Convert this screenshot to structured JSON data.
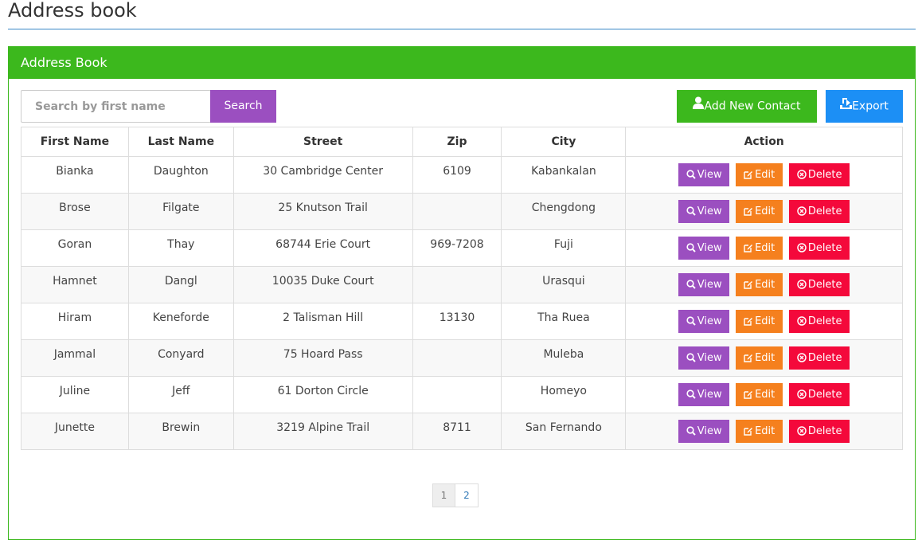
{
  "page": {
    "title": "Address book"
  },
  "panel": {
    "heading": "Address Book"
  },
  "search": {
    "placeholder": "Search by first name",
    "button_label": "Search"
  },
  "toolbar": {
    "add_label": "Add New Contact",
    "export_label": "Export"
  },
  "table": {
    "headers": [
      "First Name",
      "Last Name",
      "Street",
      "Zip",
      "City",
      "Action"
    ],
    "rows": [
      {
        "first": "Bianka",
        "last": "Daughton",
        "street": "30 Cambridge Center",
        "zip": "6109",
        "city": "Kabankalan"
      },
      {
        "first": "Brose",
        "last": "Filgate",
        "street": "25 Knutson Trail",
        "zip": "",
        "city": "Chengdong"
      },
      {
        "first": "Goran",
        "last": "Thay",
        "street": "68744 Erie Court",
        "zip": "969-7208",
        "city": "Fuji"
      },
      {
        "first": "Hamnet",
        "last": "Dangl",
        "street": "10035 Duke Court",
        "zip": "",
        "city": "Urasqui"
      },
      {
        "first": "Hiram",
        "last": "Keneforde",
        "street": "2 Talisman Hill",
        "zip": "13130",
        "city": "Tha Ruea"
      },
      {
        "first": "Jammal",
        "last": "Conyard",
        "street": "75 Hoard Pass",
        "zip": "",
        "city": "Muleba"
      },
      {
        "first": "Juline",
        "last": "Jeff",
        "street": "61 Dorton Circle",
        "zip": "",
        "city": "Homeyo"
      },
      {
        "first": "Junette",
        "last": "Brewin",
        "street": "3219 Alpine Trail",
        "zip": "8711",
        "city": "San Fernando"
      }
    ],
    "actions": {
      "view": "View",
      "edit": "Edit",
      "delete": "Delete"
    }
  },
  "pagination": {
    "pages": [
      "1",
      "2"
    ],
    "current": "1"
  },
  "colors": {
    "green": "#3cb81d",
    "purple": "#9b4fc0",
    "orange": "#f5801e",
    "red": "#f4093b",
    "blue": "#1c8ff5",
    "link": "#337ab7"
  },
  "icons": {
    "add": "user-icon",
    "export": "export-icon",
    "view": "zoom-icon",
    "edit": "edit-icon",
    "delete": "close-circle-icon"
  }
}
